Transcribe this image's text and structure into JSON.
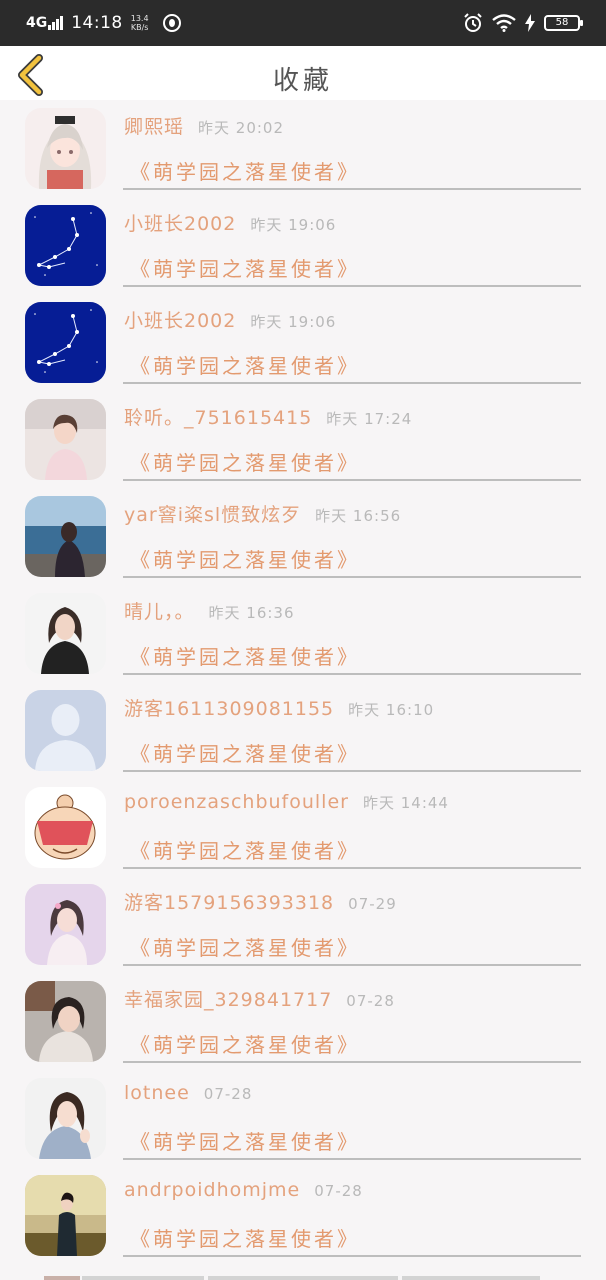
{
  "status_bar": {
    "network": "4G",
    "time": "14:18",
    "speed_value": "13.4",
    "speed_unit": "KB/s",
    "battery": "58",
    "icons": [
      "signal-icon",
      "app-notification-icon",
      "alarm-icon",
      "wifi-icon",
      "charging-icon",
      "battery-icon"
    ]
  },
  "header": {
    "title": "收藏",
    "back_icon": "chevron-left-icon"
  },
  "colors": {
    "username": "#e4a27d",
    "game_title": "#e39a6f",
    "timestamp": "#b9b9b9",
    "back_arrow": "#f2c23e"
  },
  "favorites": [
    {
      "username": "卿熙瑶",
      "time": "昨天 20:02",
      "game": "《萌学园之落星使者》",
      "avatar": "anime-girl-avatar"
    },
    {
      "username": "小班长2002",
      "time": "昨天 19:06",
      "game": "《萌学园之落星使者》",
      "avatar": "constellation-avatar"
    },
    {
      "username": "小班长2002",
      "time": "昨天 19:06",
      "game": "《萌学园之落星使者》",
      "avatar": "constellation-avatar"
    },
    {
      "username": "聆听。_751615415",
      "time": "昨天 17:24",
      "game": "《萌学园之落星使者》",
      "avatar": "girl-photo-avatar"
    },
    {
      "username": "yar窨i粢sl惯致炫歹",
      "time": "昨天 16:56",
      "game": "《萌学园之落星使者》",
      "avatar": "seaside-photo-avatar"
    },
    {
      "username": "晴儿，。",
      "time": "昨天 16:36",
      "game": "《萌学园之落星使者》",
      "avatar": "girl-black-jacket-avatar"
    },
    {
      "username": "游客1611309081155",
      "time": "昨天 16:10",
      "game": "《萌学园之落星使者》",
      "avatar": "default-user-avatar"
    },
    {
      "username": "poroenzaschbufouller",
      "time": "昨天 14:44",
      "game": "《萌学园之落星使者》",
      "avatar": "cartoon-girl-avatar"
    },
    {
      "username": "游客1579156393318",
      "time": "07-29",
      "game": "《萌学园之落星使者》",
      "avatar": "pink-girl-avatar"
    },
    {
      "username": "幸福家园_329841717",
      "time": "07-28",
      "game": "《萌学园之落星使者》",
      "avatar": "child-photo-avatar"
    },
    {
      "username": "lotnee",
      "time": "07-28",
      "game": "《萌学园之落星使者》",
      "avatar": "selfie-girl-avatar"
    },
    {
      "username": "andrpoidhomjme",
      "time": "07-28",
      "game": "《萌学园之落星使者》",
      "avatar": "qipao-photo-avatar"
    }
  ]
}
